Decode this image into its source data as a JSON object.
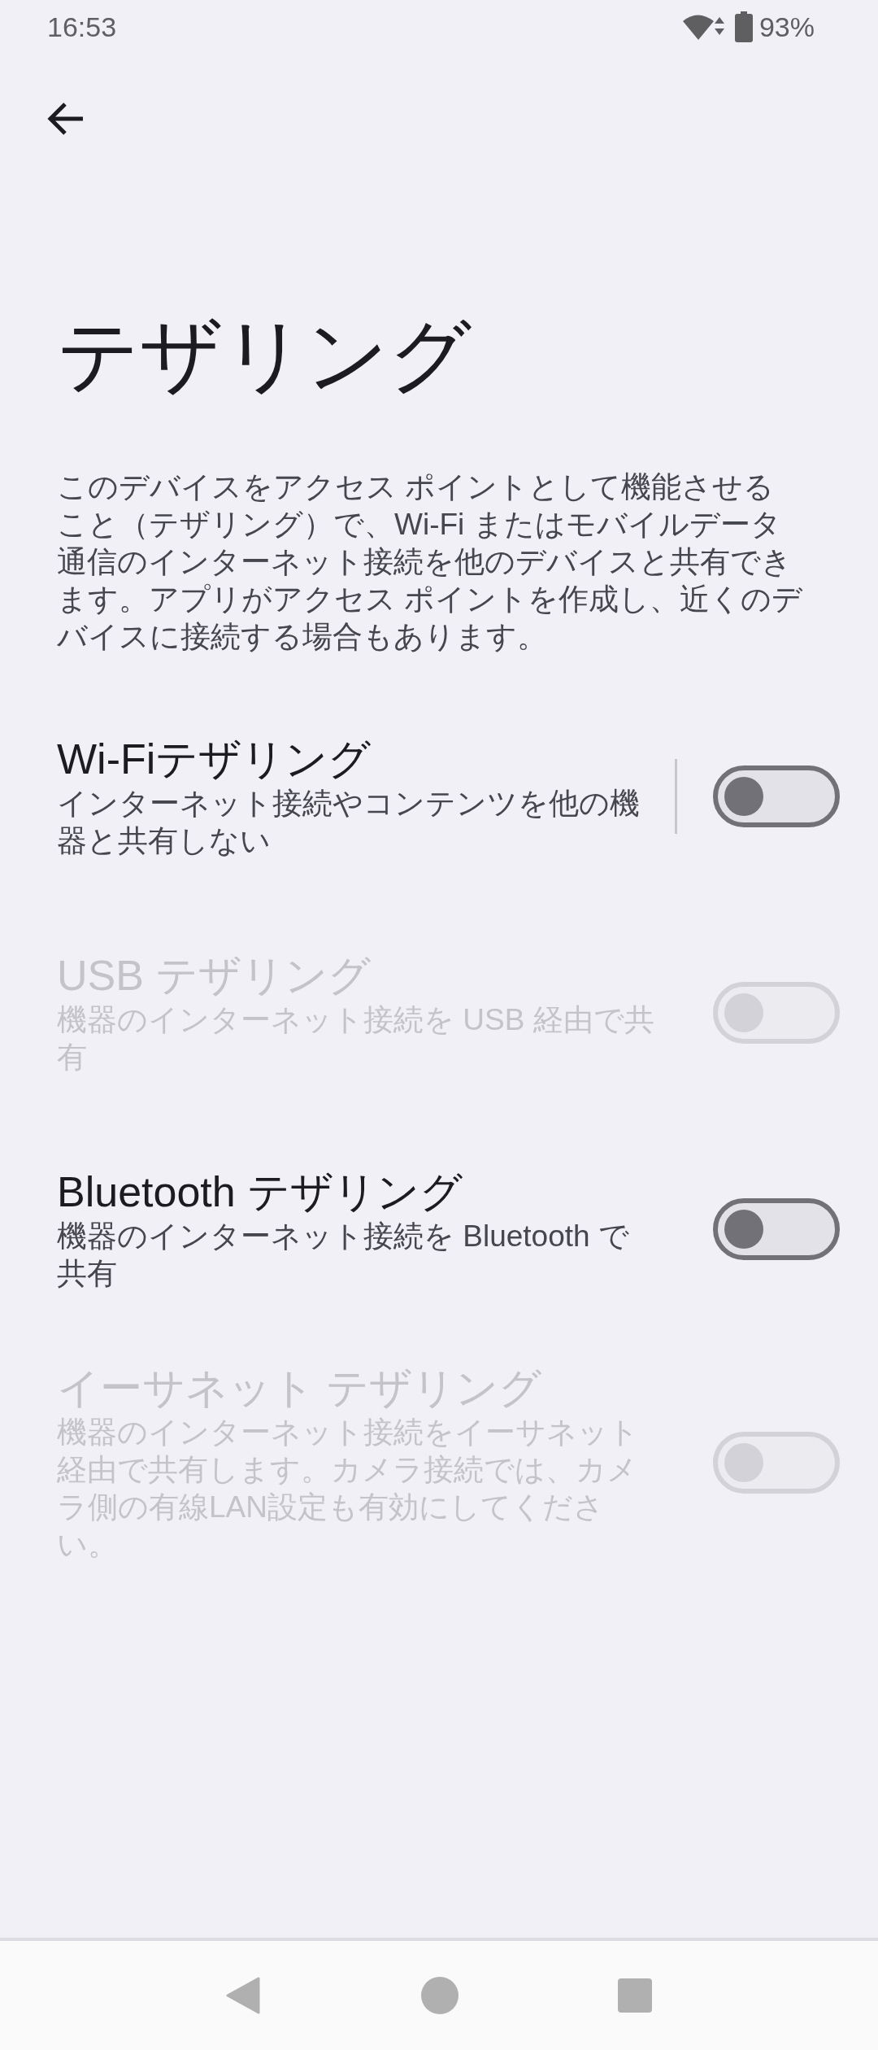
{
  "status_bar": {
    "time": "16:53",
    "battery": "93%"
  },
  "title": "テザリング",
  "description": "このデバイスをアクセス ポイントとして機能させること（テザリング）で、Wi-Fi またはモバイルデータ通信のインターネット接続を他のデバイスと共有できます。アプリがアクセス ポイントを作成し、近くのデバイスに接続する場合もあります。",
  "settings": [
    {
      "title": "Wi-Fiテザリング",
      "summary": "インターネット接続やコンテンツを他の機器と共有しない",
      "on": false,
      "disabled": false,
      "divider": true
    },
    {
      "title": "USB テザリング",
      "summary": "機器のインターネット接続を USB 経由で共有",
      "on": false,
      "disabled": true,
      "divider": false
    },
    {
      "title": "Bluetooth テザリング",
      "summary": "機器のインターネット接続を Bluetooth で共有",
      "on": false,
      "disabled": false,
      "divider": false
    },
    {
      "title": "イーサネット テザリング",
      "summary": "機器のインターネット接続をイーサネット経由で共有します。カメラ接続では、カメラ側の有線LAN設定も有効にしてください。",
      "on": false,
      "disabled": true,
      "divider": false
    }
  ]
}
